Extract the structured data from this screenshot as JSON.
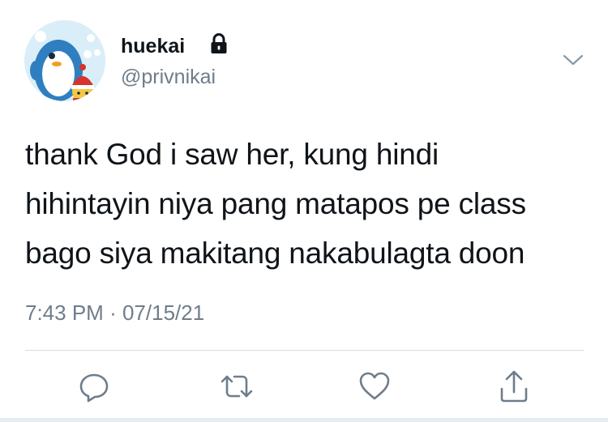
{
  "tweet": {
    "author": {
      "display_name": "huekai",
      "handle": "@privnikai",
      "protected_icon": "lock-icon",
      "avatar": "penguin-with-red-hat-avatar"
    },
    "text_lines": [
      "thank God i saw her, kung hindi",
      "hihintayin niya pang matapos pe class",
      "bago siya makitang nakabulagta doon"
    ],
    "time": "7:43 PM",
    "separator": "·",
    "date": "07/15/21",
    "menu_icon": "chevron-down-icon"
  },
  "actions": [
    {
      "name": "reply",
      "icon": "reply-icon"
    },
    {
      "name": "retweet",
      "icon": "retweet-icon"
    },
    {
      "name": "like",
      "icon": "heart-icon"
    },
    {
      "name": "share",
      "icon": "share-icon"
    }
  ],
  "colors": {
    "text": "#0f1419",
    "secondary": "#6f7d8a",
    "divider": "#d5dce2",
    "icon": "#6f7d8a"
  }
}
